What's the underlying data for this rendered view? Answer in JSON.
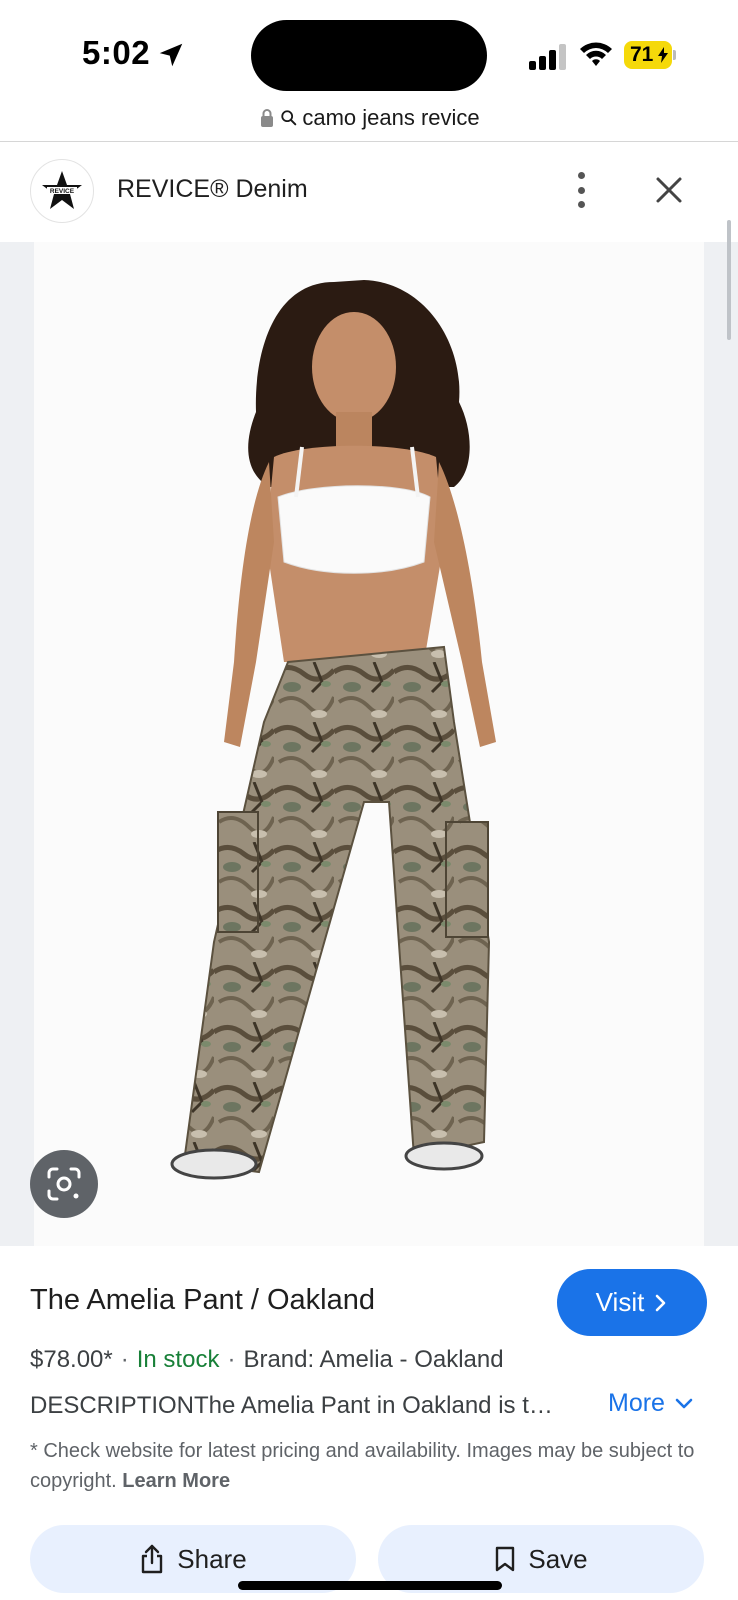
{
  "status_bar": {
    "time": "5:02",
    "battery": "71"
  },
  "url_bar": {
    "query": "camo jeans revice"
  },
  "site": {
    "name": "REVICE® Denim",
    "logo_text": "REVICE"
  },
  "product": {
    "title": "The Amelia Pant / Oakland",
    "price": "$78.00*",
    "stock": "In stock",
    "brand": "Brand: Amelia - Oakland",
    "description": "DESCRIPTIONThe Amelia Pant in Oakland is t…",
    "more_label": "More",
    "visit_label": "Visit",
    "disclaimer": "* Check website for latest pricing and availability. Images may be subject to copyright.",
    "learn_more": "Learn More"
  },
  "actions": {
    "share_label": "Share",
    "save_label": "Save"
  },
  "icons": [
    "location-arrow-icon",
    "signal-icon",
    "wifi-icon",
    "battery-icon",
    "lock-icon",
    "search-icon",
    "more-vert-icon",
    "close-icon",
    "lens-icon",
    "chevron-right-icon",
    "chevron-down-icon",
    "share-icon",
    "bookmark-icon"
  ],
  "colors": {
    "accent": "#1a73e8",
    "in_stock": "#188038",
    "action_bg": "#e8f0fe",
    "battery": "#f5d90a"
  }
}
